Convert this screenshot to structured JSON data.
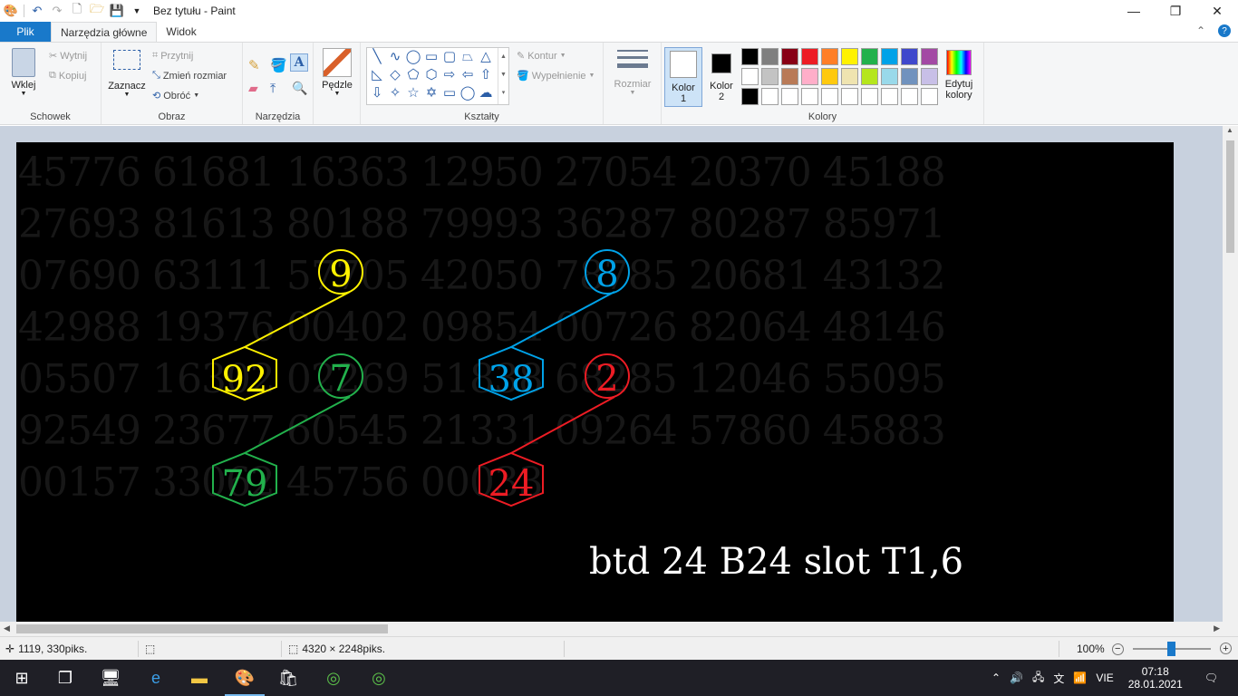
{
  "window": {
    "title": "Bez tytułu - Paint"
  },
  "tabs": {
    "file": "Plik",
    "home": "Narzędzia główne",
    "view": "Widok"
  },
  "ribbon": {
    "clipboard": {
      "label": "Schowek",
      "paste": "Wklej",
      "cut": "Wytnij",
      "copy": "Kopiuj"
    },
    "image": {
      "label": "Obraz",
      "select": "Zaznacz",
      "crop": "Przytnij",
      "resize": "Zmień rozmiar",
      "rotate": "Obróć"
    },
    "tools": {
      "label": "Narzędzia"
    },
    "brushes": {
      "label": "Pędzle"
    },
    "shapes": {
      "label": "Kształty",
      "outline": "Kontur",
      "fill": "Wypełnienie"
    },
    "size": {
      "label": "Rozmiar"
    },
    "colors": {
      "label": "Kolory",
      "color1": "Kolor",
      "color1_num": "1",
      "color2": "Kolor",
      "color2_num": "2",
      "edit": "Edytuj",
      "edit2": "kolory",
      "palette_row1": [
        "#000000",
        "#7f7f7f",
        "#880015",
        "#ed1c24",
        "#ff7f27",
        "#fff200",
        "#22b14c",
        "#00a2e8",
        "#3f48cc",
        "#a349a4"
      ],
      "palette_row2": [
        "#ffffff",
        "#c3c3c3",
        "#b97a57",
        "#ffaec9",
        "#ffc90e",
        "#efe4b0",
        "#b5e61d",
        "#99d9ea",
        "#7092be",
        "#c8bfe7"
      ],
      "palette_row3": [
        "#000000",
        "#ffffff",
        "#ffffff",
        "#ffffff",
        "#ffffff",
        "#ffffff",
        "#ffffff",
        "#ffffff",
        "#ffffff",
        "#ffffff"
      ]
    }
  },
  "canvas": {
    "bg_rows": [
      "45776 61681 16363 12950 27054 20370 45188",
      "27693 81613 80188 79993 36287 80287 85971",
      "07690 63111 57705 42050 78785 20681 43132",
      "42988 19376 00402 09854 00726 82064 48146",
      "05507 16302 02269 51838 68285 12046 55095",
      "92549 23677 60545 21331 09264 57860 45883",
      "00157 33062 45756 00033"
    ],
    "nodes": [
      {
        "text": "9",
        "color": "#fff200"
      },
      {
        "text": "92",
        "color": "#fff200"
      },
      {
        "text": "7",
        "color": "#22b14c"
      },
      {
        "text": "79",
        "color": "#22b14c"
      },
      {
        "text": "8",
        "color": "#00a2e8"
      },
      {
        "text": "38",
        "color": "#00a2e8"
      },
      {
        "text": "2",
        "color": "#ed1c24"
      },
      {
        "text": "24",
        "color": "#ed1c24"
      }
    ],
    "caption": "btd 24 B24 slot T1,6"
  },
  "status": {
    "cursor": "1119, 330piks.",
    "size": "4320 × 2248piks.",
    "zoom": "100%"
  },
  "taskbar": {
    "lang": "VIE",
    "time": "07:18",
    "date": "28.01.2021"
  }
}
